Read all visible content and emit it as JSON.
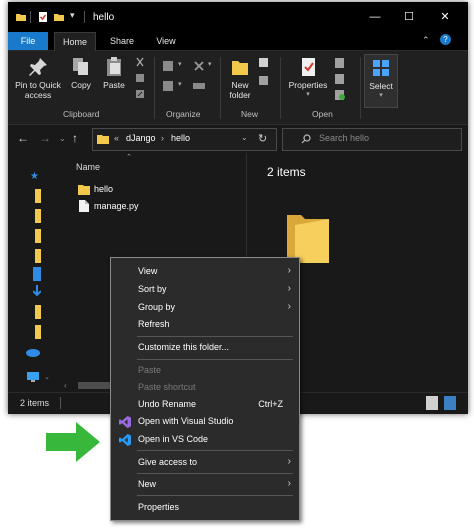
{
  "window": {
    "title": "hello",
    "controls": {
      "minimize": "—",
      "maximize": "☐",
      "close": "✕"
    }
  },
  "ribbon": {
    "tabs": [
      "File",
      "Home",
      "Share",
      "View"
    ],
    "groups": {
      "clipboard": "Clipboard",
      "organize": "Organize",
      "new": "New",
      "open": "Open"
    },
    "buttons": {
      "pin_to_quick_access_line1": "Pin to Quick",
      "pin_to_quick_access_line2": "access",
      "copy": "Copy",
      "paste": "Paste",
      "new_folder_line1": "New",
      "new_folder_line2": "folder",
      "properties": "Properties",
      "select": "Select"
    }
  },
  "address_bar": {
    "chevrons": "«",
    "path": [
      "dJango",
      "hello"
    ],
    "search_placeholder": "Search hello"
  },
  "content": {
    "column_header": "Name",
    "files": [
      {
        "name": "hello",
        "icon": "folder-icon"
      },
      {
        "name": "manage.py",
        "icon": "file-icon"
      }
    ]
  },
  "preview": {
    "items_count": "2 items"
  },
  "status_bar": {
    "items": "2 items"
  },
  "context_menu": {
    "items": [
      {
        "label": "View",
        "submenu": true
      },
      {
        "label": "Sort by",
        "submenu": true
      },
      {
        "label": "Group by",
        "submenu": true
      },
      {
        "label": "Refresh"
      },
      {
        "label": "Customize this folder..."
      },
      {
        "label": "Paste",
        "disabled": true
      },
      {
        "label": "Paste shortcut",
        "disabled": true
      },
      {
        "label": "Undo Rename",
        "shortcut": "Ctrl+Z"
      },
      {
        "label": "Open with Visual Studio",
        "icon": "visual-studio-icon"
      },
      {
        "label": "Open in VS Code",
        "icon": "vscode-icon"
      },
      {
        "label": "Give access to",
        "submenu": true
      },
      {
        "label": "New",
        "submenu": true
      },
      {
        "label": "Properties"
      }
    ]
  },
  "colors": {
    "accent": "#1979ca",
    "arrow": "#37b83a",
    "folder": "#f3c94d",
    "background": "#191919"
  }
}
